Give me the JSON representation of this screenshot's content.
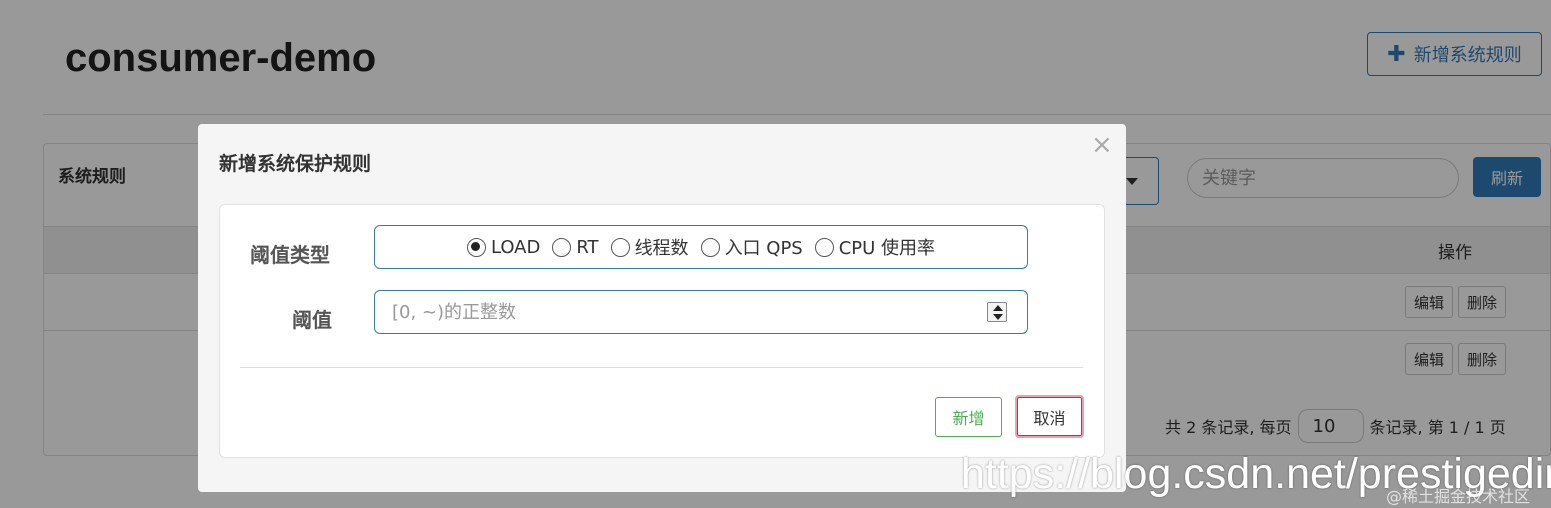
{
  "page": {
    "app_name": "consumer-demo",
    "add_rule_label": "新增系统规则",
    "panel_title": "系统规则",
    "search_placeholder": "关键字",
    "refresh_label": "刷新",
    "column_ops": "操作",
    "rows": [
      {
        "edit": "编辑",
        "delete": "删除"
      },
      {
        "edit": "编辑",
        "delete": "删除"
      }
    ],
    "pager": {
      "prefix": "共 2 条记录, 每页",
      "page_size": "10",
      "suffix": "条记录, 第 1 / 1 页"
    }
  },
  "modal": {
    "title": "新增系统保护规则",
    "close_glyph": "×",
    "threshold_type_label": "阈值类型",
    "threshold_label": "阈值",
    "options": [
      "LOAD",
      "RT",
      "线程数",
      "入口 QPS",
      "CPU 使用率"
    ],
    "selected_option": "LOAD",
    "threshold_placeholder": "[0, ~)的正整数",
    "save_label": "新增",
    "cancel_label": "取消"
  },
  "watermark": {
    "url": "https://blog.csdn.net/prestigeding",
    "community": "@稀土掘金技术社区"
  },
  "colors": {
    "primary": "#337ab7",
    "success": "#4caf50",
    "danger_focus": "#c9302c"
  }
}
